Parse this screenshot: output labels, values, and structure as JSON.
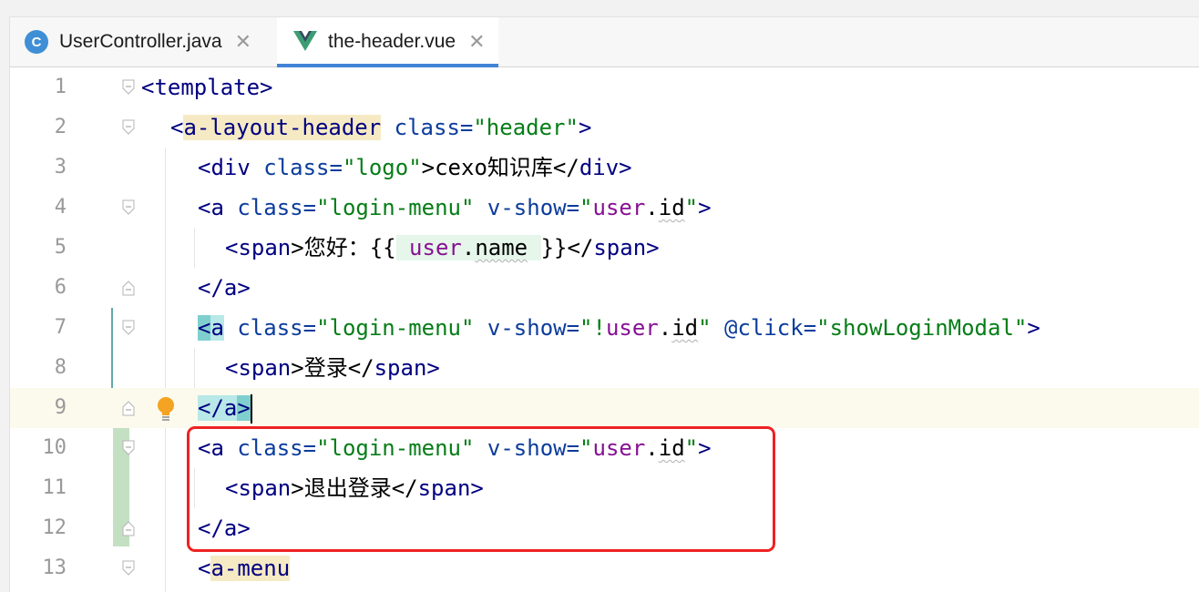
{
  "tabs": [
    {
      "label": "UserController.java",
      "icon": "java-class-icon",
      "active": false
    },
    {
      "label": "the-header.vue",
      "icon": "vue-icon",
      "active": true
    }
  ],
  "icon_text": {
    "java": "C"
  },
  "lines": {
    "1": {
      "num": "1",
      "t1": "<template>"
    },
    "2": {
      "num": "2",
      "t1": "<",
      "t2": "a-layout-header",
      "t3": " class=",
      "t4": "\"header\"",
      "t5": ">"
    },
    "3": {
      "num": "3",
      "t1": "<div",
      "t2": " class=",
      "t3": "\"logo\"",
      "t4": ">cexo知识库</",
      "t5": "div",
      "t6": ">"
    },
    "4": {
      "num": "4",
      "t1": "<a",
      "t2": " class=",
      "t3": "\"login-menu\"",
      "t4": " v-show=",
      "t5": "\"",
      "t6": "user",
      "t7": ".",
      "t8": "id",
      "t9": "\"",
      "t10": ">"
    },
    "5": {
      "num": "5",
      "t1": "<span",
      "t2": ">您好：{{",
      "t3": " user",
      "t4": ".",
      "t5": "name",
      "t6": " ",
      "t7": "}}</",
      "t8": "span",
      "t9": ">"
    },
    "6": {
      "num": "6",
      "t1": "</",
      "t2": "a",
      "t3": ">"
    },
    "7": {
      "num": "7",
      "t1": "<",
      "t2": "a",
      "t3": " class=",
      "t4": "\"login-menu\"",
      "t5": " v-show=",
      "t6": "\"!",
      "t7": "user",
      "t8": ".",
      "t9": "id",
      "t10": "\"",
      "t11": " @click=",
      "t12": "\"showLoginModal\"",
      "t13": ">"
    },
    "8": {
      "num": "8",
      "t1": "<span",
      "t2": ">登录</",
      "t3": "span",
      "t4": ">"
    },
    "9": {
      "num": "9",
      "t1": "</",
      "t2": "a",
      "t3": ">"
    },
    "10": {
      "num": "10",
      "t1": "<a",
      "t2": " class=",
      "t3": "\"login-menu\"",
      "t4": " v-show=",
      "t5": "\"",
      "t6": "user",
      "t7": ".",
      "t8": "id",
      "t9": "\"",
      "t10": ">"
    },
    "11": {
      "num": "11",
      "t1": "<span",
      "t2": ">退出登录</",
      "t3": "span",
      "t4": ">"
    },
    "12": {
      "num": "12",
      "t1": "</",
      "t2": "a",
      "t3": ">"
    },
    "13": {
      "num": "13",
      "t1": "<",
      "t2": "a-menu"
    }
  },
  "colors": {
    "tag": "#000080",
    "attribute": "#0b3c9c",
    "string": "#067d17",
    "expression": "#871094",
    "highlight_box": "#ee2222",
    "active_tab_underline": "#4283d6"
  }
}
